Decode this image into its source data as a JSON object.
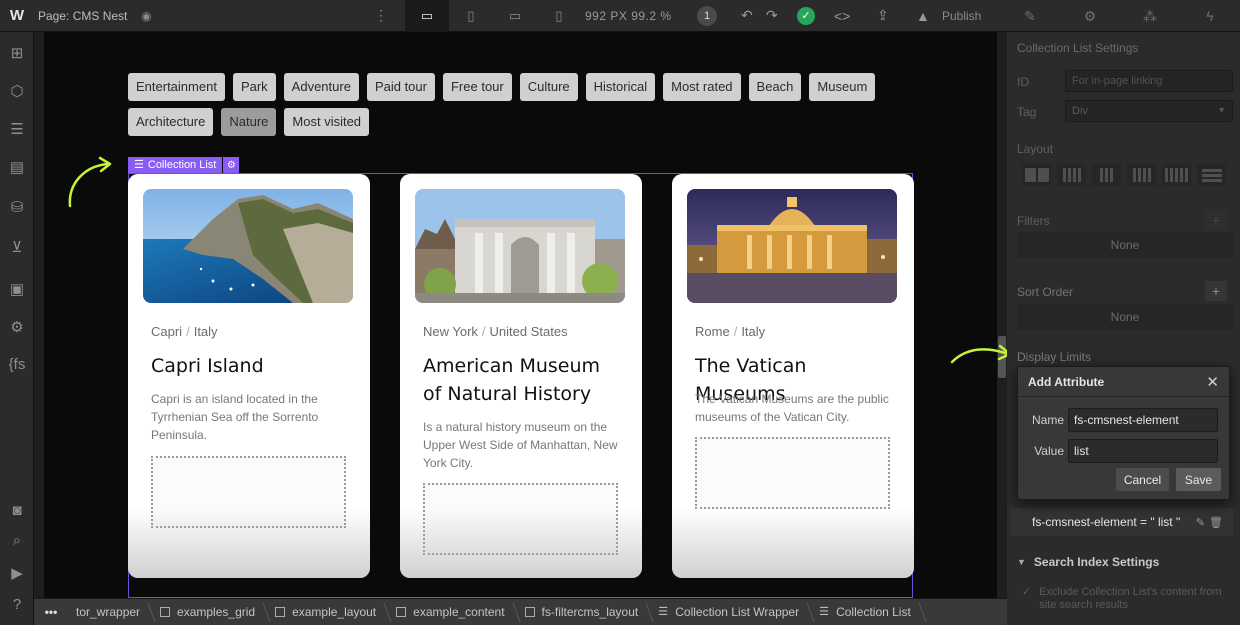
{
  "topbar": {
    "logo": "W",
    "page_name": "Page: CMS Nest",
    "dims": "992 PX  99.2 %",
    "badge": "1",
    "publish": "Publish"
  },
  "tags": [
    {
      "label": "Entertainment",
      "state": "normal"
    },
    {
      "label": "Park",
      "state": "normal"
    },
    {
      "label": "Adventure",
      "state": "normal"
    },
    {
      "label": "Paid tour",
      "state": "normal"
    },
    {
      "label": "Free tour",
      "state": "normal"
    },
    {
      "label": "Culture",
      "state": "normal"
    },
    {
      "label": "Historical",
      "state": "normal"
    },
    {
      "label": "Most rated",
      "state": "normal"
    },
    {
      "label": "Beach",
      "state": "normal"
    },
    {
      "label": "Museum",
      "state": "normal"
    },
    {
      "label": "Architecture",
      "state": "normal"
    },
    {
      "label": "Nature",
      "state": "dim"
    },
    {
      "label": "Most visited",
      "state": "normal"
    }
  ],
  "collection_label": "Collection List",
  "cards": [
    {
      "city": "Capri",
      "country": "Italy",
      "title": "Capri Island",
      "description": "Capri is an island located in the Tyrrhenian Sea off the Sorrento Peninsula."
    },
    {
      "city": "New York",
      "country": "United States",
      "title": "American Museum of Natural History",
      "description": "Is a natural history museum on the Upper West Side of Manhattan, New York City."
    },
    {
      "city": "Rome",
      "country": "Italy",
      "title": "The Vatican Museums",
      "description": "The Vatican Museums are the public museums of the Vatican City."
    }
  ],
  "right_panel": {
    "header": "Collection List Settings",
    "id_label": "ID",
    "id_placeholder": "For in-page linking",
    "tag_label": "Tag",
    "tag_value": "Div",
    "layout_label": "Layout",
    "filters_label": "Filters",
    "filters_value": "None",
    "sort_label": "Sort Order",
    "sort_value": "None",
    "display_limits": "Display Limits",
    "attribute_line": "fs-cmsnest-element = \" list \"",
    "search_index": "Search Index Settings",
    "exclude_text": "Exclude Collection List's content from site search results"
  },
  "dialog": {
    "title": "Add Attribute",
    "name_label": "Name",
    "name_value": "fs-cmsnest-element",
    "value_label": "Value",
    "value_value": "list",
    "cancel": "Cancel",
    "save": "Save"
  },
  "breadcrumb": [
    {
      "label": "tor_wrapper",
      "icon": "box"
    },
    {
      "label": "examples_grid",
      "icon": "box"
    },
    {
      "label": "example_layout",
      "icon": "box"
    },
    {
      "label": "example_content",
      "icon": "box"
    },
    {
      "label": "fs-filtercms_layout",
      "icon": "box"
    },
    {
      "label": "Collection List Wrapper",
      "icon": "stack"
    },
    {
      "label": "Collection List",
      "icon": "stack"
    }
  ],
  "colors": {
    "accent_purple": "#8a5cf6",
    "arrow_green": "#c7f23a",
    "check_green": "#26a65b"
  }
}
